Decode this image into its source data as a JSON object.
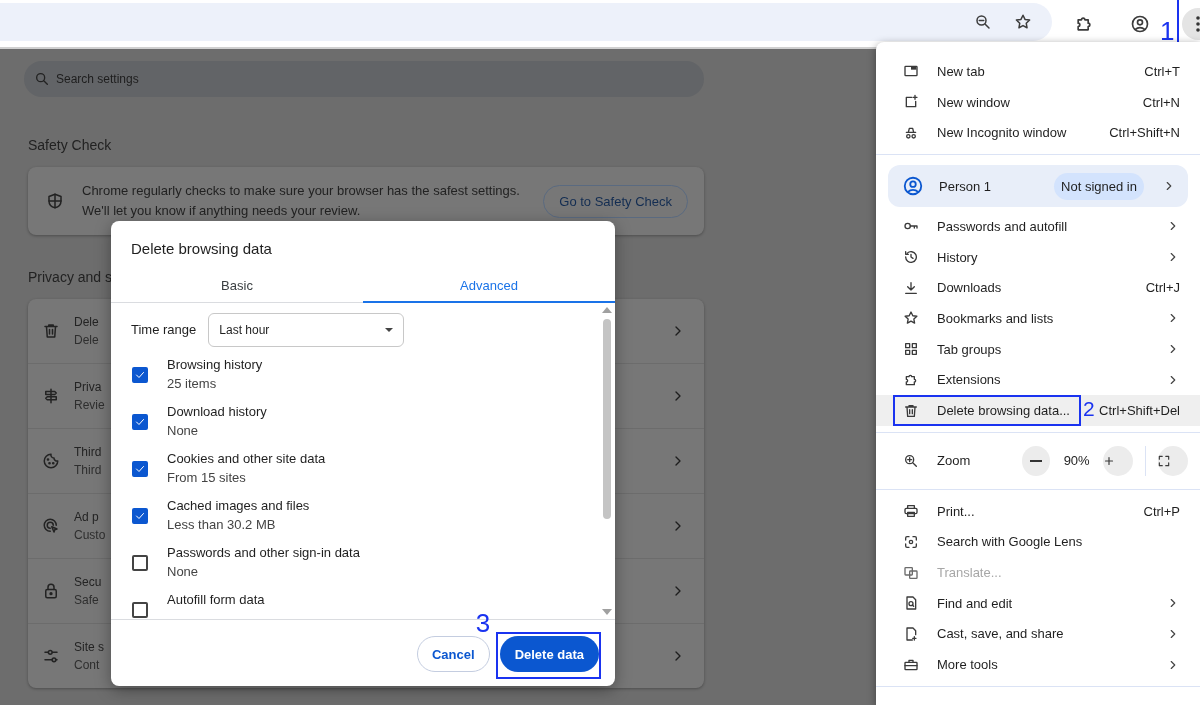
{
  "toolbar": {
    "annotation": "1"
  },
  "settings": {
    "search": {
      "placeholder": "Search settings"
    },
    "safety_check": {
      "heading": "Safety Check",
      "text": "Chrome regularly checks to make sure your browser has the safest settings.\nWe'll let you know if anything needs your review.",
      "button": "Go to Safety Check"
    },
    "privacy": {
      "heading": "Privacy and s",
      "rows": [
        {
          "title": "Dele",
          "subtitle": "Dele"
        },
        {
          "title": "Priva",
          "subtitle": "Revie"
        },
        {
          "title": "Third",
          "subtitle": "Third"
        },
        {
          "title": "Ad p",
          "subtitle": "Custo"
        },
        {
          "title": "Secu",
          "subtitle": "Safe"
        },
        {
          "title": "Site s",
          "subtitle": "Cont"
        }
      ]
    }
  },
  "dialog": {
    "title": "Delete browsing data",
    "tabs": [
      {
        "label": "Basic",
        "selected": false
      },
      {
        "label": "Advanced",
        "selected": true
      }
    ],
    "time_range": {
      "label": "Time range",
      "value": "Last hour"
    },
    "items": [
      {
        "label": "Browsing history",
        "detail": "25 items",
        "checked": true
      },
      {
        "label": "Download history",
        "detail": "None",
        "checked": true
      },
      {
        "label": "Cookies and other site data",
        "detail": "From 15 sites",
        "checked": true
      },
      {
        "label": "Cached images and files",
        "detail": "Less than 30.2 MB",
        "checked": true
      },
      {
        "label": "Passwords and other sign-in data",
        "detail": "None",
        "checked": false
      },
      {
        "label": "Autofill form data",
        "checked": false
      }
    ],
    "cancel": "Cancel",
    "confirm": "Delete data",
    "annotation": "3"
  },
  "menu": {
    "sections": [
      [
        {
          "label": "New tab",
          "shortcut": "Ctrl+T",
          "submenu": false,
          "disabled": false,
          "selected": false
        },
        {
          "label": "New window",
          "shortcut": "Ctrl+N",
          "submenu": false,
          "disabled": false,
          "selected": false
        },
        {
          "label": "New Incognito window",
          "shortcut": "Ctrl+Shift+N",
          "submenu": false,
          "disabled": false,
          "selected": false
        }
      ],
      [
        {
          "kind": "profile",
          "label": "Person 1",
          "badge": "Not signed in",
          "submenu": true
        },
        {
          "label": "Passwords and autofill",
          "submenu": true,
          "disabled": false,
          "selected": false
        },
        {
          "label": "History",
          "submenu": true,
          "disabled": false,
          "selected": false
        },
        {
          "label": "Downloads",
          "shortcut": "Ctrl+J",
          "submenu": false,
          "disabled": false,
          "selected": false
        },
        {
          "label": "Bookmarks and lists",
          "submenu": true,
          "disabled": false,
          "selected": false
        },
        {
          "label": "Tab groups",
          "submenu": true,
          "disabled": false,
          "selected": false
        },
        {
          "label": "Extensions",
          "submenu": true,
          "disabled": false,
          "selected": false
        },
        {
          "label": "Delete browsing data...",
          "shortcut": "Ctrl+Shift+Del",
          "submenu": false,
          "disabled": false,
          "selected": true,
          "annotation": "2"
        }
      ],
      [
        {
          "kind": "zoom",
          "label": "Zoom",
          "value": "90%"
        }
      ],
      [
        {
          "label": "Print...",
          "shortcut": "Ctrl+P",
          "submenu": false,
          "disabled": false,
          "selected": false
        },
        {
          "label": "Search with Google Lens",
          "submenu": false,
          "disabled": false,
          "selected": false
        },
        {
          "label": "Translate...",
          "submenu": false,
          "disabled": true,
          "selected": false
        },
        {
          "label": "Find and edit",
          "submenu": true,
          "disabled": false,
          "selected": false
        },
        {
          "label": "Cast, save, and share",
          "submenu": true,
          "disabled": false,
          "selected": false
        },
        {
          "label": "More tools",
          "submenu": true,
          "disabled": false,
          "selected": false
        }
      ]
    ]
  }
}
